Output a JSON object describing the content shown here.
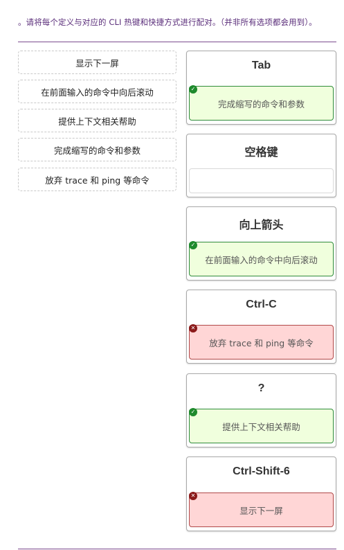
{
  "instruction": "。请将每个定义与对应的 CLI 热键和快捷方式进行配对。（并非所有选项都会用到）。",
  "choices": [
    "显示下一屏",
    "在前面输入的命令中向后滚动",
    "提供上下文相关帮助",
    "完成缩写的命令和参数",
    "放弃 trace 和 ping 等命令"
  ],
  "targets": [
    {
      "term": "Tab",
      "answer": "完成缩写的命令和参数",
      "status": "correct",
      "status_icon": "check-icon"
    },
    {
      "term": "空格键",
      "answer": "",
      "status": "empty",
      "status_icon": ""
    },
    {
      "term": "向上箭头",
      "answer": "在前面输入的命令中向后滚动",
      "status": "correct",
      "status_icon": "check-icon"
    },
    {
      "term": "Ctrl-C",
      "answer": "放弃 trace 和 ping 等命令",
      "status": "incorrect",
      "status_icon": "x-icon"
    },
    {
      "term": "?",
      "answer": "提供上下文相关帮助",
      "status": "correct",
      "status_icon": "check-icon"
    },
    {
      "term": "Ctrl-Shift-6",
      "answer": "显示下一屏",
      "status": "incorrect",
      "status_icon": "x-icon"
    }
  ],
  "colors": {
    "correct_bg": "#f0ffdd",
    "correct_border": "#2e8b3a",
    "incorrect_bg": "#ffd6d6",
    "incorrect_border": "#b04848",
    "accent": "#7b4a8e"
  }
}
